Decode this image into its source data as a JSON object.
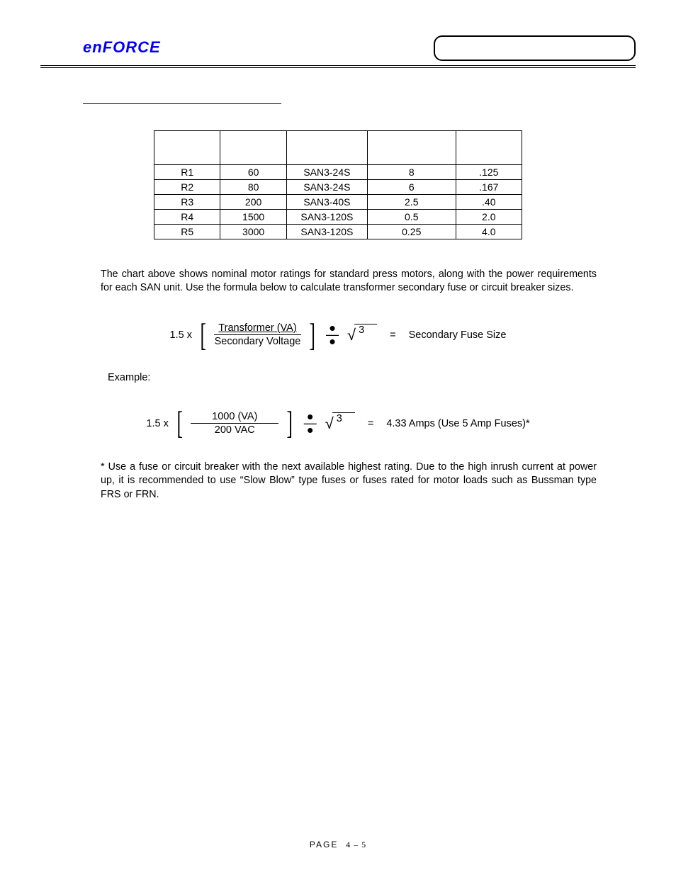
{
  "header": {
    "logo": "enFORCE"
  },
  "table": {
    "headers": [
      "",
      "",
      "",
      "",
      ""
    ],
    "rows": [
      {
        "c1": "R1",
        "c2": "60",
        "c3": "SAN3-24S",
        "c4": "8",
        "c5": ".125"
      },
      {
        "c1": "R2",
        "c2": "80",
        "c3": "SAN3-24S",
        "c4": "6",
        "c5": ".167"
      },
      {
        "c1": "R3",
        "c2": "200",
        "c3": "SAN3-40S",
        "c4": "2.5",
        "c5": ".40"
      },
      {
        "c1": "R4",
        "c2": "1500",
        "c3": "SAN3-120S",
        "c4": "0.5",
        "c5": "2.0"
      },
      {
        "c1": "R5",
        "c2": "3000",
        "c3": "SAN3-120S",
        "c4": "0.25",
        "c5": "4.0"
      }
    ]
  },
  "paragraph1": "The chart above shows nominal motor ratings for standard press motors, along with the power requirements for each SAN unit. Use the formula below to calculate transformer secondary fuse or circuit breaker sizes.",
  "formula1": {
    "prefix": "1.5 x",
    "num": "Transformer (VA)",
    "den": "Secondary Voltage",
    "sqrtArg": "3",
    "resultLabel": "=",
    "result": "Secondary Fuse Size"
  },
  "exampleLabel": "Example:",
  "formula2": {
    "prefix": "1.5 x",
    "num": "1000 (VA)",
    "den": "200 VAC",
    "sqrtArg": "3",
    "resultLabel": "=",
    "result": "4.33 Amps (Use 5 Amp Fuses)*"
  },
  "footnote": "* Use a fuse or circuit breaker with the next available highest rating. Due to the high inrush current at power up, it is recommended to use “Slow Blow” type fuses or fuses rated for motor loads such as Bussman type FRS or FRN.",
  "footer": {
    "label": "PAGE",
    "value": "4 – 5"
  }
}
